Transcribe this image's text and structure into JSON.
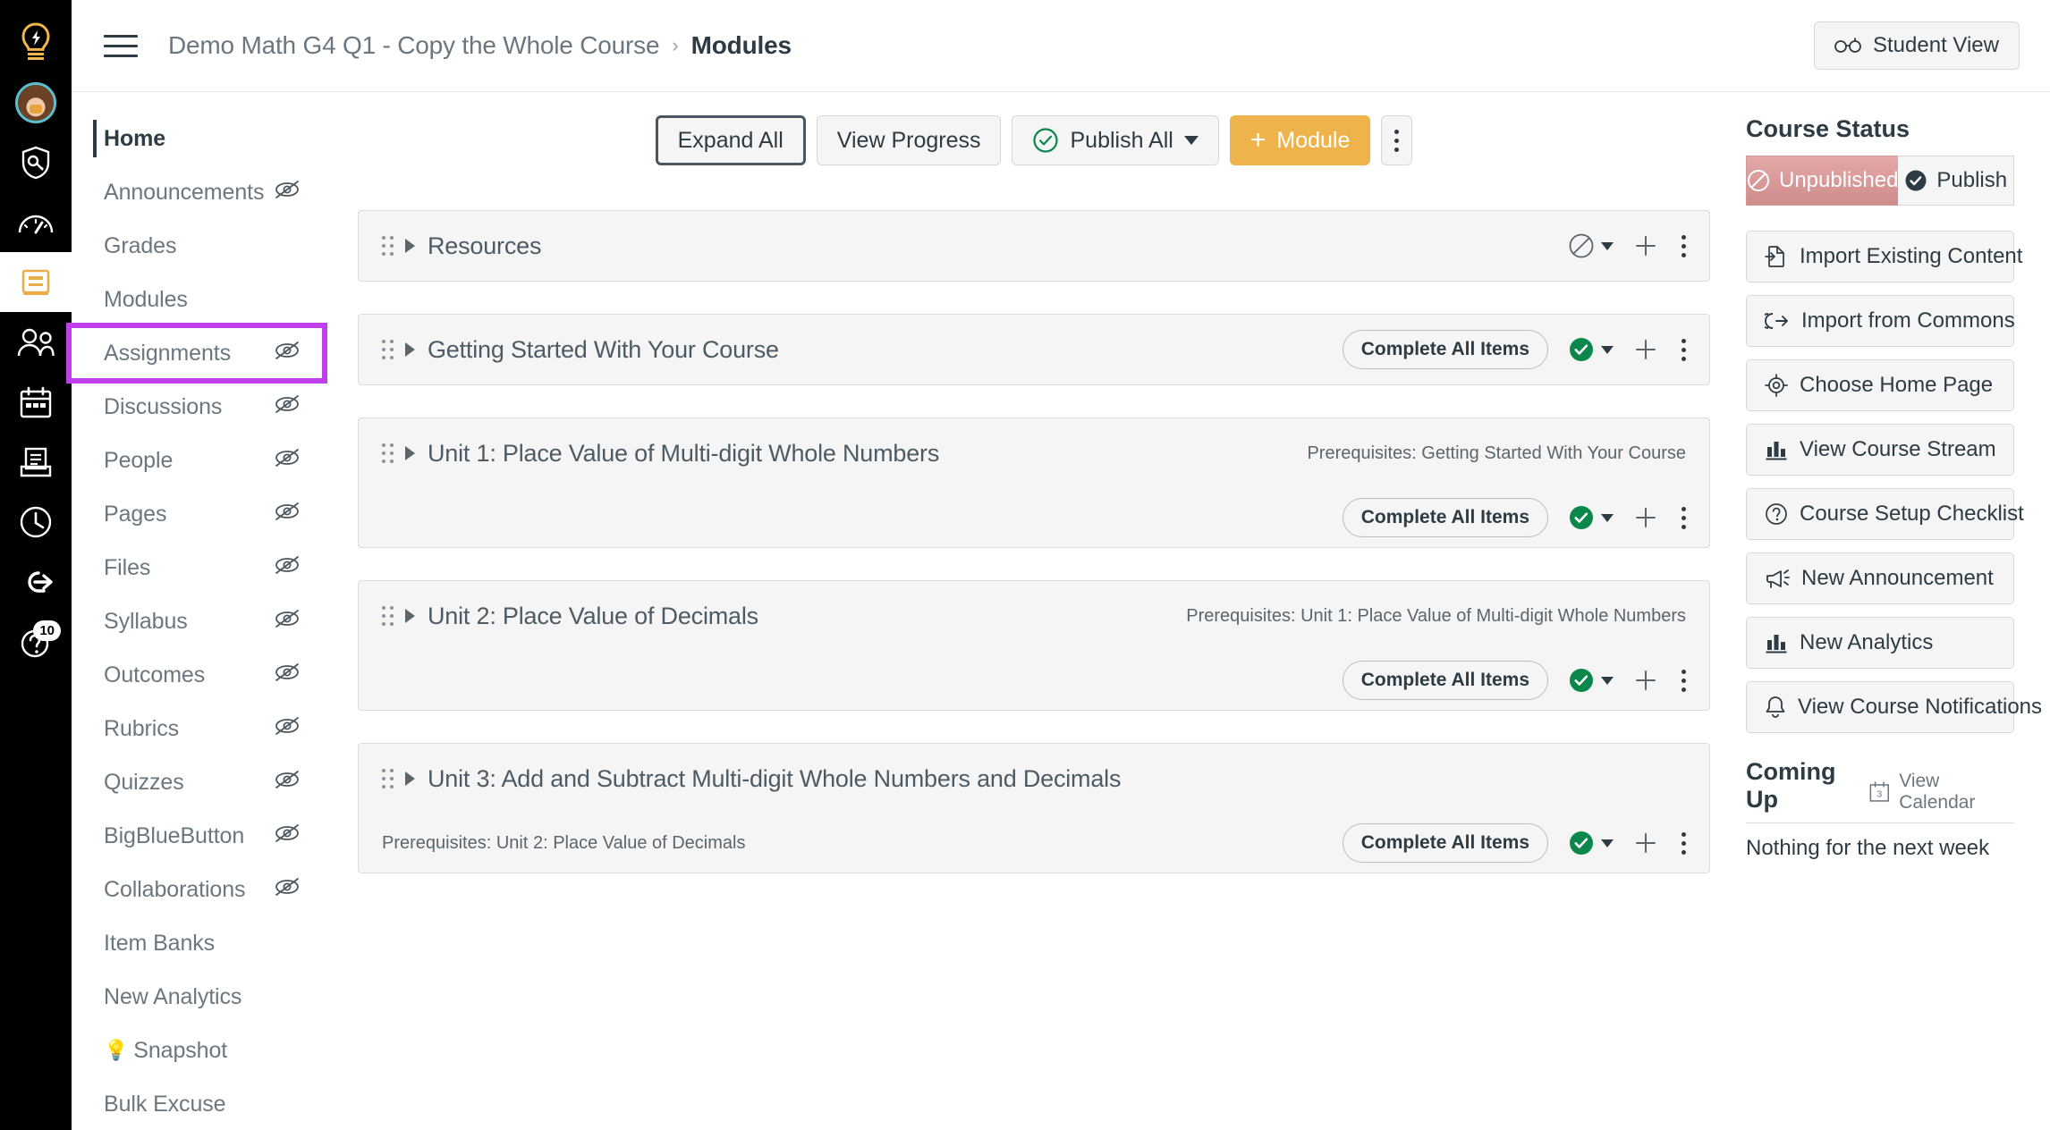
{
  "global_nav": {
    "items": [
      {
        "name": "canvas-logo",
        "icon": "lightbulb-logo-icon",
        "label": "Canvas"
      },
      {
        "name": "account",
        "icon": "avatar-icon",
        "label": "Account"
      },
      {
        "name": "admin",
        "icon": "shield-key-icon",
        "label": "Admin"
      },
      {
        "name": "dashboard",
        "icon": "gauge-icon",
        "label": "Dashboard"
      },
      {
        "name": "courses",
        "icon": "book-icon",
        "label": "Courses",
        "active": true
      },
      {
        "name": "groups",
        "icon": "people-icon",
        "label": "Groups"
      },
      {
        "name": "calendar",
        "icon": "calendar-icon",
        "label": "Calendar"
      },
      {
        "name": "inbox",
        "icon": "inbox-icon",
        "label": "Inbox"
      },
      {
        "name": "history",
        "icon": "clock-icon",
        "label": "History"
      },
      {
        "name": "commons",
        "icon": "arrow-right-circle-icon",
        "label": "Commons"
      },
      {
        "name": "help",
        "icon": "question-icon",
        "label": "Help",
        "badge": "10"
      }
    ]
  },
  "header": {
    "menu_label": "Menu",
    "breadcrumb": [
      {
        "label": "Demo Math G4 Q1 - Copy the Whole Course",
        "current": false
      },
      {
        "label": "Modules",
        "current": true
      }
    ],
    "separator": "›",
    "student_view_label": "Student View"
  },
  "course_nav": {
    "items": [
      {
        "label": "Home",
        "active": true,
        "hidden_icon": false,
        "highlighted": false
      },
      {
        "label": "Announcements",
        "active": false,
        "hidden_icon": true,
        "highlighted": false
      },
      {
        "label": "Grades",
        "active": false,
        "hidden_icon": false,
        "highlighted": false
      },
      {
        "label": "Modules",
        "active": false,
        "hidden_icon": false,
        "highlighted": false
      },
      {
        "label": "Assignments",
        "active": false,
        "hidden_icon": true,
        "highlighted": true
      },
      {
        "label": "Discussions",
        "active": false,
        "hidden_icon": true,
        "highlighted": false
      },
      {
        "label": "People",
        "active": false,
        "hidden_icon": true,
        "highlighted": false
      },
      {
        "label": "Pages",
        "active": false,
        "hidden_icon": true,
        "highlighted": false
      },
      {
        "label": "Files",
        "active": false,
        "hidden_icon": true,
        "highlighted": false
      },
      {
        "label": "Syllabus",
        "active": false,
        "hidden_icon": true,
        "highlighted": false
      },
      {
        "label": "Outcomes",
        "active": false,
        "hidden_icon": true,
        "highlighted": false
      },
      {
        "label": "Rubrics",
        "active": false,
        "hidden_icon": true,
        "highlighted": false
      },
      {
        "label": "Quizzes",
        "active": false,
        "hidden_icon": true,
        "highlighted": false
      },
      {
        "label": "BigBlueButton",
        "active": false,
        "hidden_icon": true,
        "highlighted": false
      },
      {
        "label": "Collaborations",
        "active": false,
        "hidden_icon": true,
        "highlighted": false
      },
      {
        "label": "Item Banks",
        "active": false,
        "hidden_icon": false,
        "highlighted": false
      },
      {
        "label": "New Analytics",
        "active": false,
        "hidden_icon": false,
        "highlighted": false
      },
      {
        "label": "Snapshot",
        "active": false,
        "hidden_icon": false,
        "highlighted": false,
        "emoji": "💡"
      },
      {
        "label": "Bulk Excuse",
        "active": false,
        "hidden_icon": false,
        "highlighted": false
      }
    ]
  },
  "toolbar": {
    "expand_all_label": "Expand All",
    "view_progress_label": "View Progress",
    "publish_all_label": "Publish All",
    "add_module_label": "Module",
    "add_module_plus": "+",
    "more_label": "More options"
  },
  "modules": [
    {
      "title": "Resources",
      "published": false,
      "publish_state_icon": "unpublished-circle-slash-icon",
      "requirement_pill": "",
      "prerequisites": "",
      "layout": "single"
    },
    {
      "title": "Getting Started With Your Course",
      "published": true,
      "publish_state_icon": "published-check-circle-icon",
      "requirement_pill": "Complete All Items",
      "prerequisites": "",
      "layout": "single"
    },
    {
      "title": "Unit 1: Place Value of Multi-digit Whole Numbers",
      "published": true,
      "publish_state_icon": "published-check-circle-icon",
      "requirement_pill": "Complete All Items",
      "prerequisites": "Prerequisites: Getting Started With Your Course",
      "layout": "prereq-right"
    },
    {
      "title": "Unit 2: Place Value of Decimals",
      "published": true,
      "publish_state_icon": "published-check-circle-icon",
      "requirement_pill": "Complete All Items",
      "prerequisites": "Prerequisites: Unit 1: Place Value of Multi-digit Whole Numbers",
      "layout": "prereq-right"
    },
    {
      "title": "Unit 3: Add and Subtract Multi-digit Whole Numbers and Decimals",
      "published": true,
      "publish_state_icon": "published-check-circle-icon",
      "requirement_pill": "Complete All Items",
      "prerequisites": "Prerequisites: Unit 2: Place Value of Decimals",
      "layout": "prereq-below-left"
    }
  ],
  "right_rail": {
    "course_status_title": "Course Status",
    "status_unpublished_label": "Unpublished",
    "status_publish_label": "Publish",
    "status_selected": "Unpublished",
    "buttons": [
      {
        "label": "Import Existing Content",
        "icon": "import-file-icon"
      },
      {
        "label": "Import from Commons",
        "icon": "commons-icon"
      },
      {
        "label": "Choose Home Page",
        "icon": "target-icon"
      },
      {
        "label": "View Course Stream",
        "icon": "bar-chart-icon"
      },
      {
        "label": "Course Setup Checklist",
        "icon": "question-circle-icon"
      },
      {
        "label": "New Announcement",
        "icon": "megaphone-icon"
      },
      {
        "label": "New Analytics",
        "icon": "bar-chart-icon"
      },
      {
        "label": "View Course Notifications",
        "icon": "bell-icon"
      }
    ],
    "coming_up_title": "Coming Up",
    "view_calendar_label": "View Calendar",
    "calendar_day": "3",
    "coming_up_empty": "Nothing for the next week"
  },
  "colors": {
    "accent_amber": "#EFB34B",
    "published_green": "#0B874B",
    "highlight_purple": "#C13EEC",
    "unpublished_rose": "#D49A9A",
    "avatar_ring": "#5BC0CE",
    "text_primary": "#2D3B45"
  }
}
